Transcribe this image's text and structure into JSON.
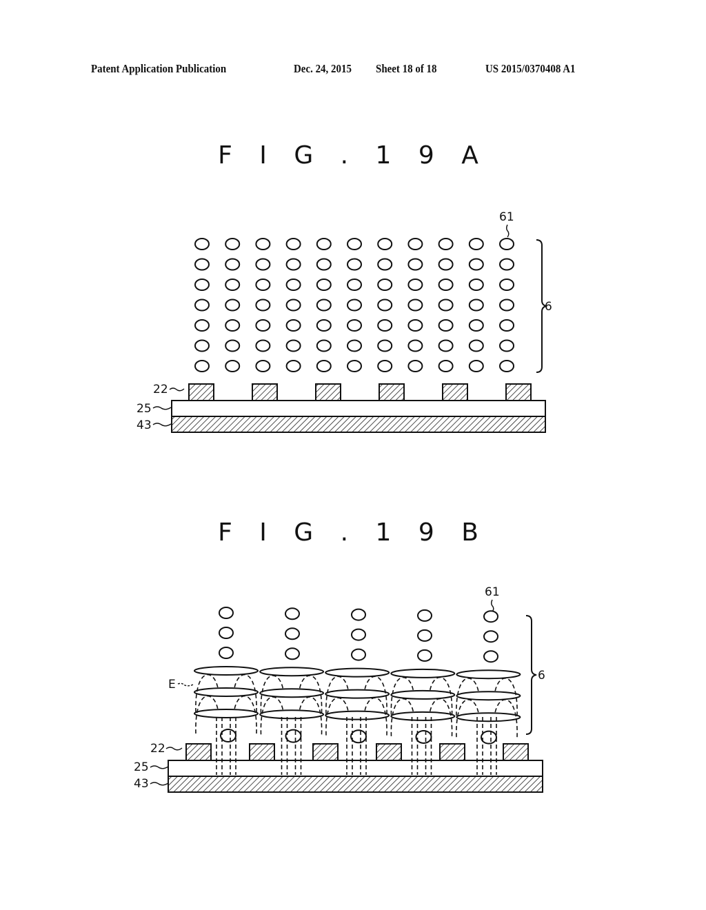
{
  "header": {
    "publication": "Patent Application Publication",
    "date": "Dec. 24, 2015",
    "sheet": "Sheet 18 of 18",
    "number": "US 2015/0370408 A1"
  },
  "figures": [
    {
      "title": "F I G . 1 9 A",
      "labels": {
        "electrode": "22",
        "insulator": "25",
        "substrate": "43",
        "particle": "61",
        "layer": "6"
      },
      "particle_grid": {
        "columns": 11,
        "rows": 7
      },
      "electrode_count": 6
    },
    {
      "title": "F I G . 1 9 B",
      "labels": {
        "electrode": "22",
        "insulator": "25",
        "substrate": "43",
        "particle": "61",
        "layer": "6",
        "field": "E"
      },
      "particle_columns": 5,
      "particles_per_column": 3,
      "ring_levels": 3,
      "electrode_count": 6
    }
  ]
}
